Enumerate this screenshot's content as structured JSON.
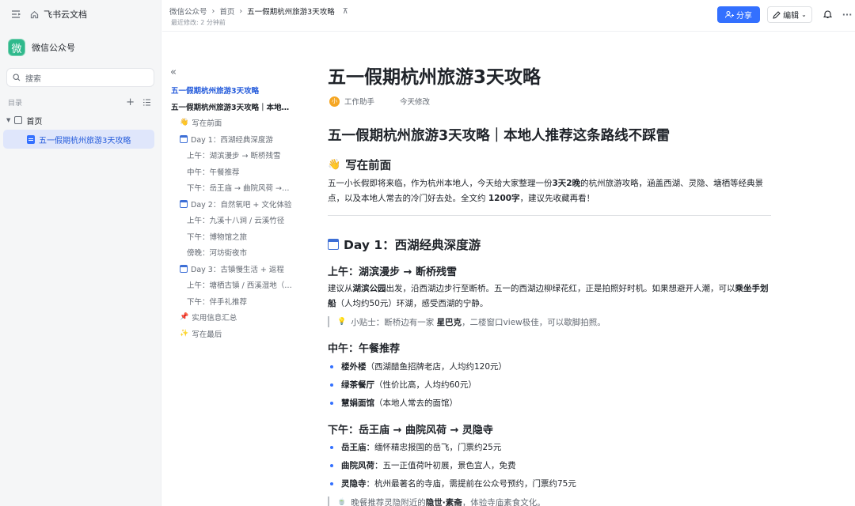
{
  "sidebar": {
    "app_name": "飞书云文档",
    "space_name": "微信公众号",
    "space_logo_char": "微",
    "search_placeholder": "搜索",
    "directory_label": "目录",
    "tree": [
      {
        "label": "首页"
      },
      {
        "label": "五一假期杭州旅游3天攻略"
      }
    ]
  },
  "header": {
    "breadcrumb": [
      "微信公众号",
      "首页",
      "五一假期杭州旅游3天攻略"
    ],
    "last_modified": "最近修改: 2 分钟前",
    "share_label": "分享",
    "edit_label": "编辑"
  },
  "toc": [
    {
      "level": 0,
      "icon": "",
      "text": "五一假期杭州旅游3天攻略"
    },
    {
      "level": 1,
      "icon": "",
      "text": "五一假期杭州旅游3天攻略｜本地…"
    },
    {
      "level": 2,
      "icon": "👋",
      "text": "写在前面"
    },
    {
      "level": 2,
      "icon": "calendar",
      "text": "Day 1：西湖经典深度游"
    },
    {
      "level": 3,
      "icon": "",
      "text": "上午：湖滨漫步 → 断桥残雪"
    },
    {
      "level": 3,
      "icon": "",
      "text": "中午：午餐推荐"
    },
    {
      "level": 3,
      "icon": "",
      "text": "下午：岳王庙 → 曲院风荷 →…"
    },
    {
      "level": 2,
      "icon": "calendar",
      "text": "Day 2：自然氧吧 + 文化体验"
    },
    {
      "level": 3,
      "icon": "",
      "text": "上午：九溪十八涧 / 云溪竹径"
    },
    {
      "level": 3,
      "icon": "",
      "text": "下午：博物馆之旅"
    },
    {
      "level": 3,
      "icon": "",
      "text": "傍晚：河坊街夜市"
    },
    {
      "level": 2,
      "icon": "calendar",
      "text": "Day 3：古镇慢生活 + 返程"
    },
    {
      "level": 3,
      "icon": "",
      "text": "上午：塘栖古镇 / 西溪湿地（…"
    },
    {
      "level": 3,
      "icon": "",
      "text": "下午：伴手礼推荐"
    },
    {
      "level": 2,
      "icon": "📌",
      "text": "实用信息汇总"
    },
    {
      "level": 2,
      "icon": "✨",
      "text": "写在最后"
    }
  ],
  "doc": {
    "title": "五一假期杭州旅游3天攻略",
    "author": "工作助手",
    "author_avatar_char": "小",
    "modified": "今天修改",
    "h1": "五一假期杭州旅游3天攻略｜本地人推荐这条路线不踩雷",
    "intro_heading": "写在前面",
    "intro_emoji": "👋",
    "intro_parts": [
      "五一小长假即将来临，作为杭州本地人，今天给大家整理一份",
      "3天2晚",
      "的杭州旅游攻略，涵盖西湖、灵隐、塘栖等经典景点，以及本地人常去的冷门好去处。全文约 ",
      "1200字",
      "，建议先收藏再看！"
    ],
    "day1_heading": "Day 1：西湖经典深度游",
    "morning_heading": "上午：湖滨漫步 → 断桥残雪",
    "morning_parts": [
      "建议从",
      "湖滨公园",
      "出发，沿西湖边步行至断桥。五一的西湖边柳绿花红，正是拍照好时机。如果想避开人潮，可以",
      "乘坐手划船",
      "（人均约50元）环湖，感受西湖的宁静。"
    ],
    "tip1_icon": "💡",
    "tip1_parts": [
      "小贴士：断桥边有一家 ",
      "星巴克",
      "，二楼窗口view极佳，可以歇脚拍照。"
    ],
    "lunch_heading": "中午：午餐推荐",
    "lunch_items": [
      {
        "name": "楼外楼",
        "desc": "（西湖醋鱼招牌老店，人均约120元）"
      },
      {
        "name": "绿茶餐厅",
        "desc": "（性价比高，人均约60元）"
      },
      {
        "name": "慧娟面馆",
        "desc": "（本地人常去的面馆）"
      }
    ],
    "afternoon_heading": "下午：岳王庙 → 曲院风荷 → 灵隐寺",
    "afternoon_items": [
      {
        "name": "岳王庙",
        "desc": "：缅怀精忠报国的岳飞，门票约25元"
      },
      {
        "name": "曲院风荷",
        "desc": "：五一正值荷叶初展，景色宜人，免费"
      },
      {
        "name": "灵隐寺",
        "desc": "：杭州最著名的寺庙，需提前在公众号预约，门票约75元"
      }
    ],
    "tip2_icon": "🍵",
    "tip2_parts": [
      "晚餐推荐灵隐附近的",
      "隐世·素斋",
      "，体验寺庙素食文化。"
    ]
  }
}
